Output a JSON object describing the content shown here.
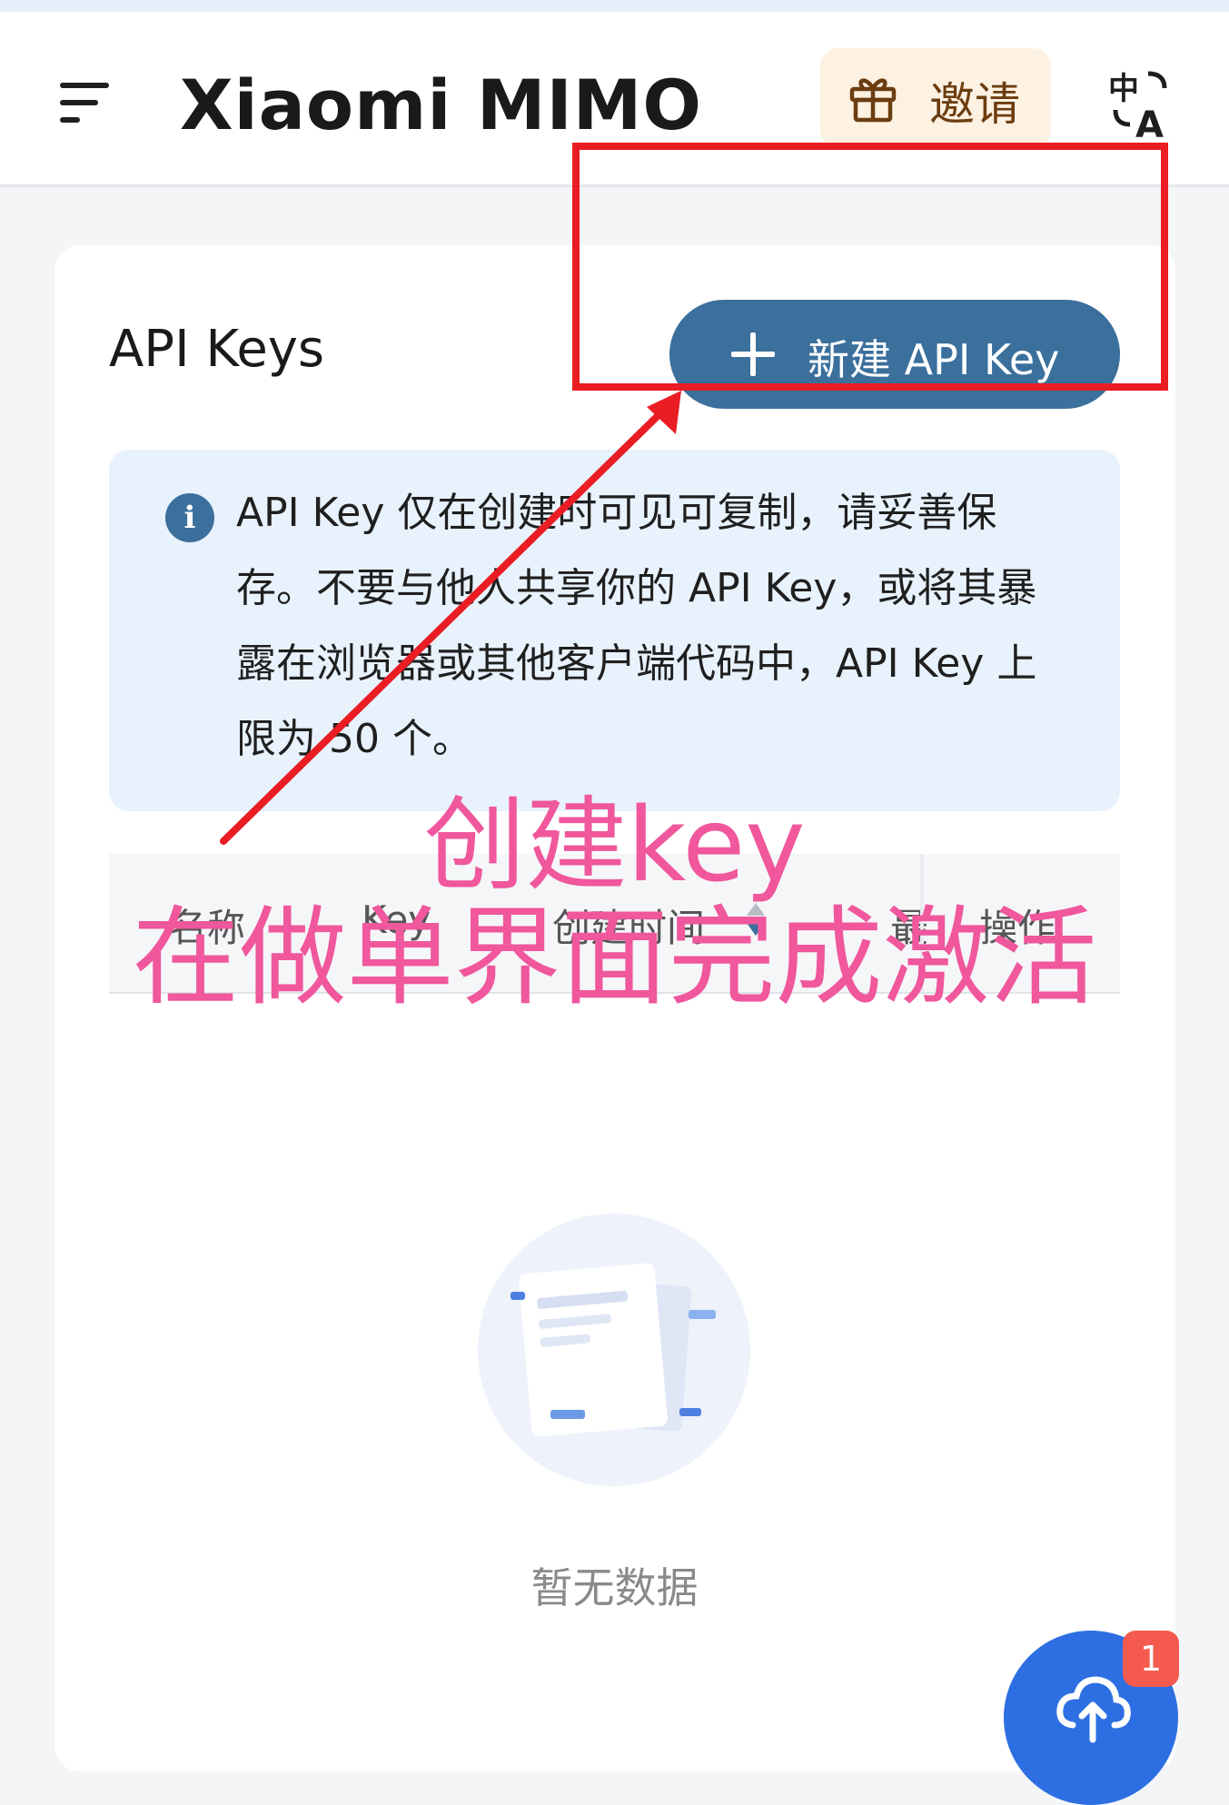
{
  "header": {
    "logo": "Xiaomi MIMO",
    "invite_label": "邀请",
    "icons": {
      "menu": "menu-icon",
      "gift": "gift-icon",
      "language": "translate-icon"
    }
  },
  "main": {
    "title": "API Keys",
    "new_key_button": "新建 API Key",
    "notice": "API Key 仅在创建时可见可复制，请妥善保存。不要与他人共享你的 API Key，或将其暴露在浏览器或其他客户端代码中，API Key 上限为 50 个。",
    "table": {
      "columns": [
        "名称",
        "Key",
        "创建时间",
        "最",
        "操作"
      ]
    },
    "empty_text": "暂无数据"
  },
  "fab": {
    "icon": "cloud-upload-icon",
    "badge": "1"
  },
  "annotation": {
    "line1": "创建key",
    "line2": "在做单界面完成激活"
  },
  "colors": {
    "primary": "#3b6f9c",
    "notice_bg": "#e8f2fc",
    "invite_bg": "#fdf1e2",
    "annotation_red": "#ea1c24",
    "annotation_pink": "#f0579c",
    "fab_blue": "#2d6fe2",
    "badge_red": "#f45b4e"
  }
}
